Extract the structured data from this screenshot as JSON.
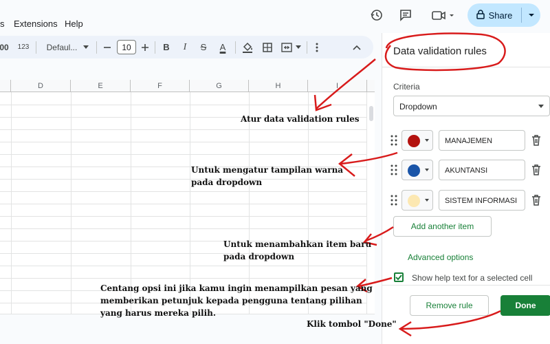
{
  "menubar": {
    "items": [
      "s",
      "Extensions",
      "Help"
    ],
    "share_label": "Share"
  },
  "toolbar": {
    "decimal_label": "00",
    "format_label": "123",
    "font_label": "Defaul...",
    "font_size": "10",
    "bold": "B",
    "italic": "I",
    "strike": "S",
    "text_color": "A"
  },
  "grid": {
    "columns": [
      "D",
      "E",
      "F",
      "G",
      "H",
      "I"
    ]
  },
  "panel": {
    "title": "Data validation rules",
    "criteria_label": "Criteria",
    "criteria_value": "Dropdown",
    "items": [
      {
        "label": "MANAJEMEN",
        "color": "#b3120f"
      },
      {
        "label": "AKUNTANSI",
        "color": "#1a55a8"
      },
      {
        "label": "SISTEM INFORMASI",
        "color": "#fce8b2"
      }
    ],
    "add_label": "Add another item",
    "advanced_label": "Advanced options",
    "help_text_label": "Show help text for a selected cell",
    "remove_label": "Remove rule",
    "done_label": "Done"
  },
  "annotations": {
    "a1": "Atur data validation rules",
    "a2_l1": "Untuk mengatur tampilan warna",
    "a2_l2": "pada dropdown",
    "a3_l1": "Untuk menambahkan item baru",
    "a3_l2": "pada dropdown",
    "a4_l1": "Centang opsi ini jika kamu ingin menampilkan pesan yang",
    "a4_l2": "memberikan petunjuk kepada pengguna tentang pilihan",
    "a4_l3": "yang harus mereka pilih.",
    "a5": "Klik tombol \"Done\""
  },
  "colors": {
    "accent_green": "#188038",
    "share_bg": "#c2e7ff",
    "annotation_red": "#d81b1b"
  }
}
